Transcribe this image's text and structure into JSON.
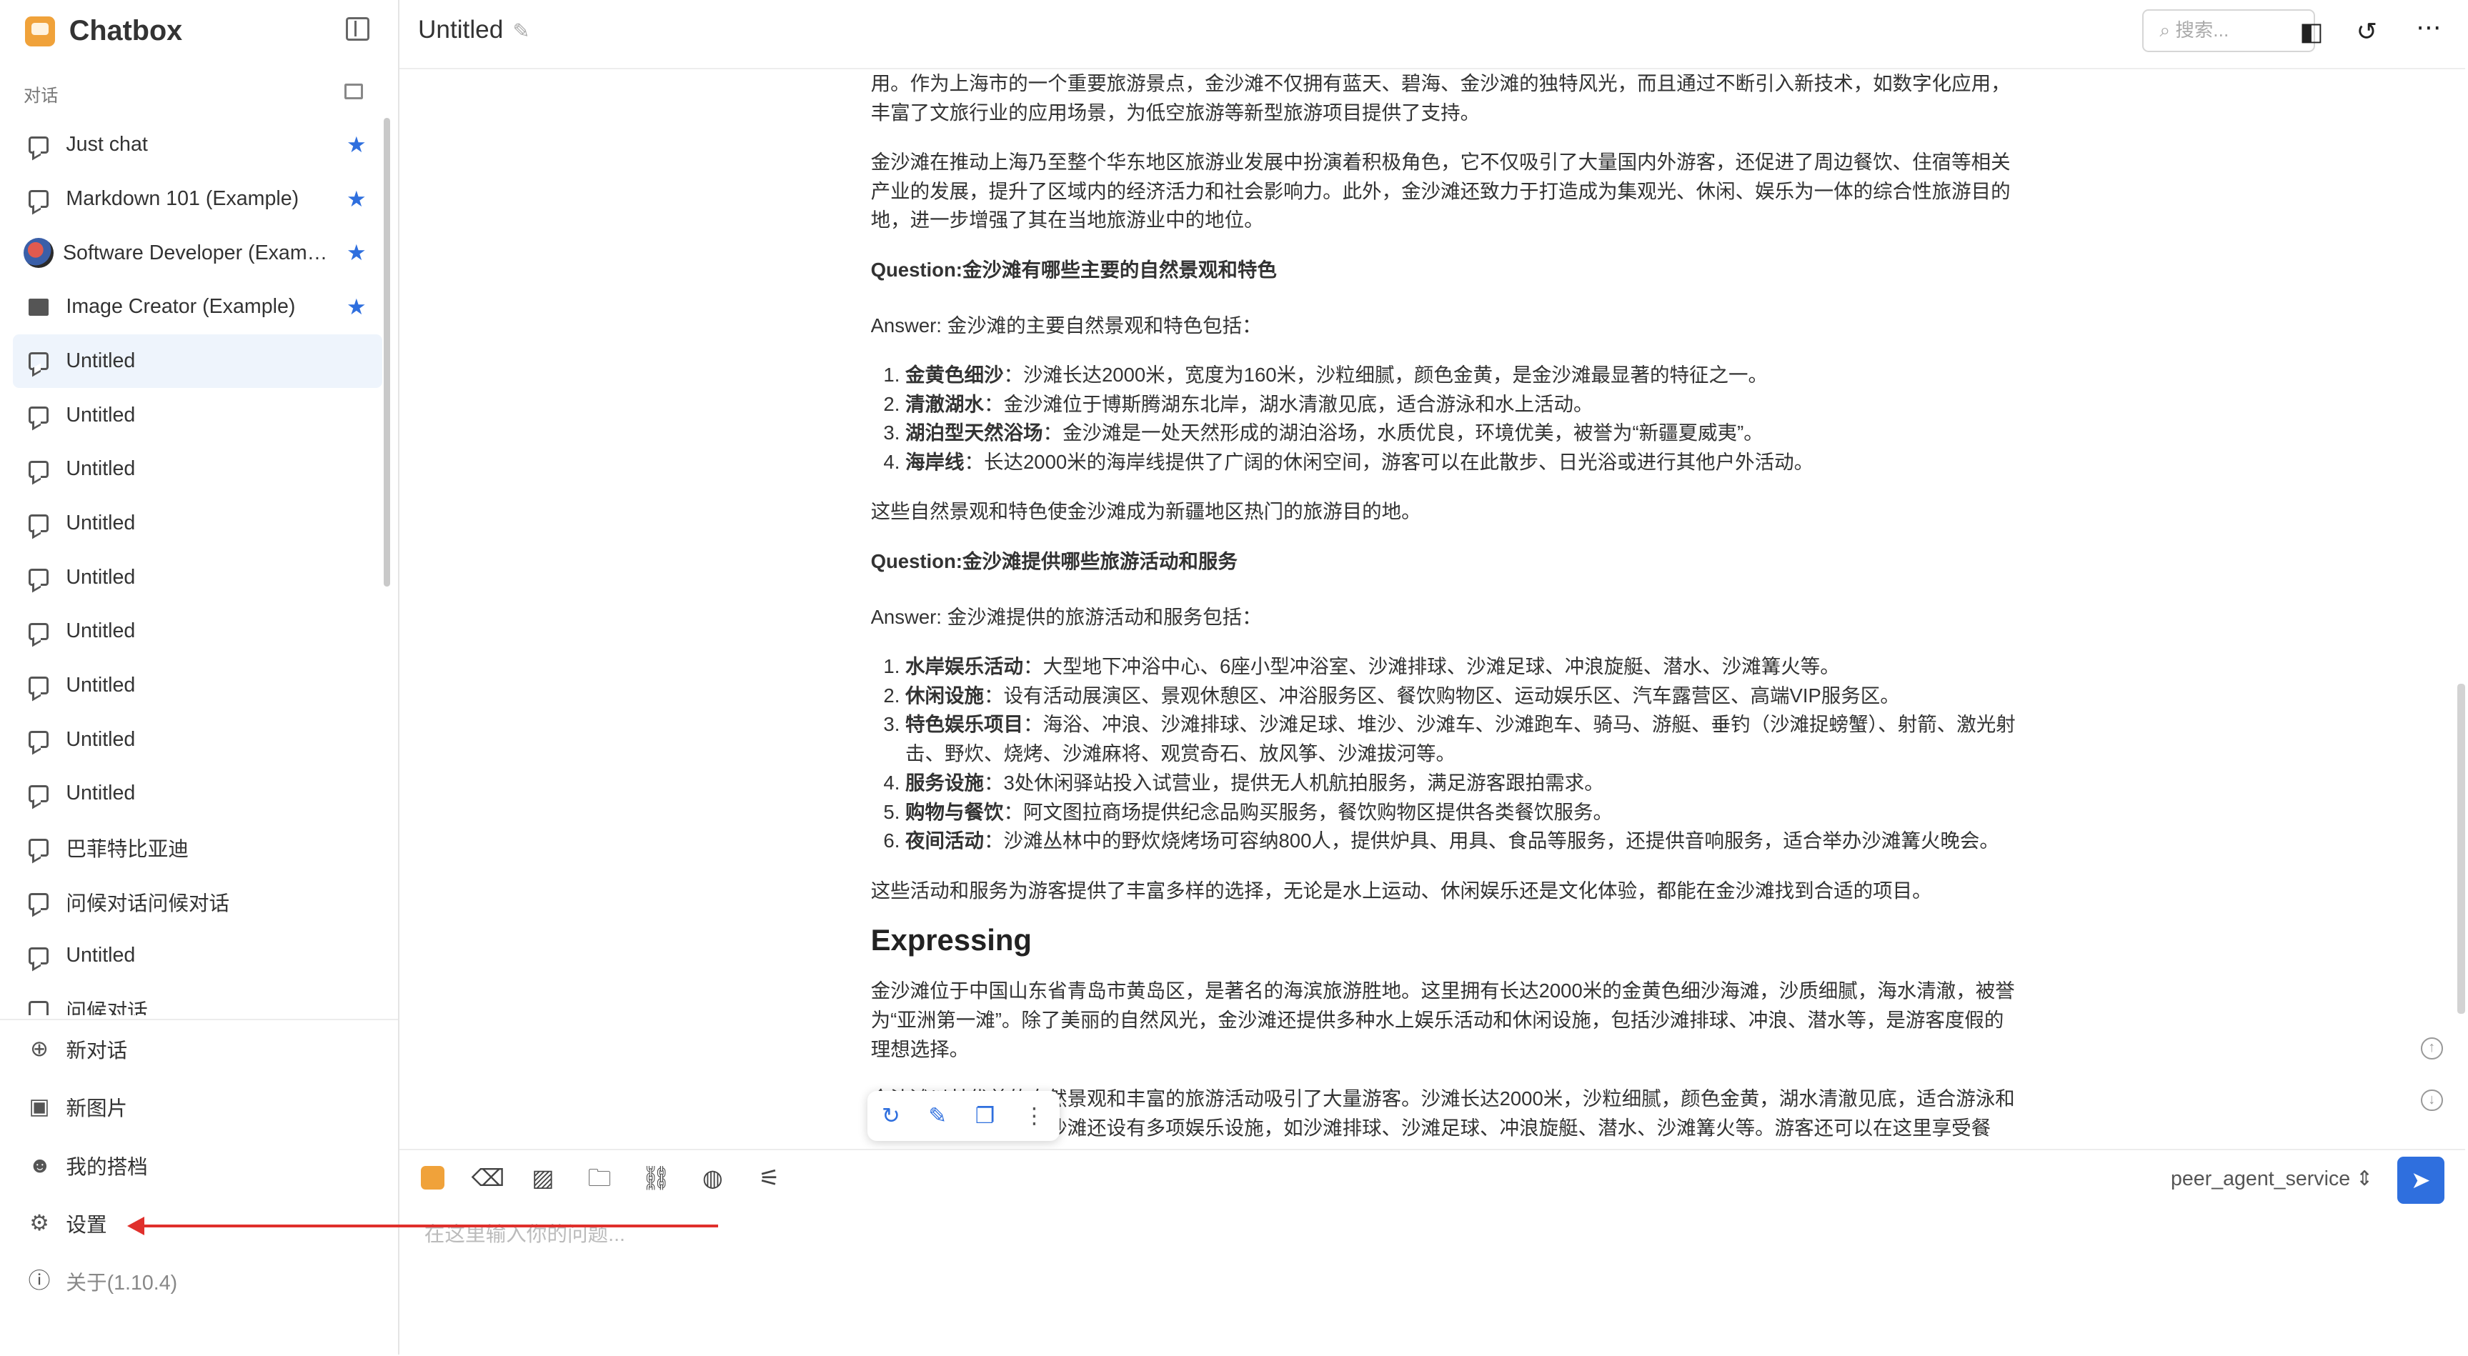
{
  "sidebar": {
    "app_name": "Chatbox",
    "section_label": "对话",
    "conversations": [
      {
        "label": "Just chat",
        "starred": true,
        "icon": "chat"
      },
      {
        "label": "Markdown 101 (Example)",
        "starred": true,
        "icon": "chat"
      },
      {
        "label": "Software Developer (Example)",
        "starred": true,
        "icon": "avatar"
      },
      {
        "label": "Image Creator (Example)",
        "starred": true,
        "icon": "image"
      },
      {
        "label": "Untitled",
        "active": true,
        "icon": "chat"
      },
      {
        "label": "Untitled",
        "icon": "chat"
      },
      {
        "label": "Untitled",
        "icon": "chat"
      },
      {
        "label": "Untitled",
        "icon": "chat"
      },
      {
        "label": "Untitled",
        "icon": "chat"
      },
      {
        "label": "Untitled",
        "icon": "chat"
      },
      {
        "label": "Untitled",
        "icon": "chat"
      },
      {
        "label": "Untitled",
        "icon": "chat"
      },
      {
        "label": "Untitled",
        "icon": "chat"
      },
      {
        "label": "巴菲特比亚迪",
        "icon": "chat"
      },
      {
        "label": "问候对话问候对话",
        "icon": "chat"
      },
      {
        "label": "Untitled",
        "icon": "chat"
      },
      {
        "label": "问候对话",
        "icon": "chat"
      }
    ],
    "menu": {
      "new_chat": "新对话",
      "new_image": "新图片",
      "my_copilots": "我的搭档",
      "settings": "设置",
      "about": "关于(1.10.4)"
    }
  },
  "header": {
    "title": "Untitled",
    "search_placeholder": "搜索..."
  },
  "content": {
    "p0": "用。作为上海市的一个重要旅游景点，金沙滩不仅拥有蓝天、碧海、金沙滩的独特风光，而且通过不断引入新技术，如数字化应用，丰富了文旅行业的应用场景，为低空旅游等新型旅游项目提供了支持。",
    "p1": "金沙滩在推动上海乃至整个华东地区旅游业发展中扮演着积极角色，它不仅吸引了大量国内外游客，还促进了周边餐饮、住宿等相关产业的发展，提升了区域内的经济活力和社会影响力。此外，金沙滩还致力于打造成为集观光、休闲、娱乐为一体的综合性旅游目的地，进一步增强了其在当地旅游业中的地位。",
    "q1": "Question:金沙滩有哪些主要的自然景观和特色",
    "a1_intro": "Answer: 金沙滩的主要自然景观和特色包括：",
    "list1": [
      {
        "k": "金黄色细沙",
        "v": "：沙滩长达2000米，宽度为160米，沙粒细腻，颜色金黄，是金沙滩最显著的特征之一。"
      },
      {
        "k": "清澈湖水",
        "v": "：金沙滩位于博斯腾湖东北岸，湖水清澈见底，适合游泳和水上活动。"
      },
      {
        "k": "湖泊型天然浴场",
        "v": "：金沙滩是一处天然形成的湖泊浴场，水质优良，环境优美，被誉为“新疆夏威夷”。"
      },
      {
        "k": "海岸线",
        "v": "：长达2000米的海岸线提供了广阔的休闲空间，游客可以在此散步、日光浴或进行其他户外活动。"
      }
    ],
    "a1_outro": "这些自然景观和特色使金沙滩成为新疆地区热门的旅游目的地。",
    "q2": "Question:金沙滩提供哪些旅游活动和服务",
    "a2_intro": "Answer: 金沙滩提供的旅游活动和服务包括：",
    "list2": [
      {
        "k": "水岸娱乐活动",
        "v": "：大型地下冲浴中心、6座小型冲浴室、沙滩排球、沙滩足球、冲浪旋艇、潜水、沙滩篝火等。"
      },
      {
        "k": "休闲设施",
        "v": "：设有活动展演区、景观休憩区、冲浴服务区、餐饮购物区、运动娱乐区、汽车露营区、高端VIP服务区。"
      },
      {
        "k": "特色娱乐项目",
        "v": "：海浴、冲浪、沙滩排球、沙滩足球、堆沙、沙滩车、沙滩跑车、骑马、游艇、垂钓（沙滩捉螃蟹）、射箭、激光射击、野炊、烧烤、沙滩麻将、观赏奇石、放风筝、沙滩拔河等。"
      },
      {
        "k": "服务设施",
        "v": "：3处休闲驿站投入试营业，提供无人机航拍服务，满足游客跟拍需求。"
      },
      {
        "k": "购物与餐饮",
        "v": "：阿文图拉商场提供纪念品购买服务，餐饮购物区提供各类餐饮服务。"
      },
      {
        "k": "夜间活动",
        "v": "：沙滩丛林中的野炊烧烤场可容纳800人，提供炉具、用具、食品等服务，还提供音响服务，适合举办沙滩篝火晚会。"
      }
    ],
    "a2_outro": "这些活动和服务为游客提供了丰富多样的选择，无论是水上运动、休闲娱乐还是文化体验，都能在金沙滩找到合适的项目。",
    "h_expressing": "Expressing",
    "p_exp1": "金沙滩位于中国山东省青岛市黄岛区，是著名的海滨旅游胜地。这里拥有长达2000米的金黄色细沙海滩，沙质细腻，海水清澈，被誉为“亚洲第一滩”。除了美丽的自然风光，金沙滩还提供多种水上娱乐活动和休闲设施，包括沙滩排球、冲浪、潜水等，是游客度假的理想选择。",
    "p_exp2": "金沙滩以其优美的自然景观和丰富的旅游活动吸引了大量游客。沙滩长达2000米，沙粒细腻，颜色金黄，湖水清澈见底，适合游泳和水上活动。此外，金沙滩还设有多项娱乐设施，如沙滩排球、沙滩足球、冲浪旋艇、潜水、沙滩篝火等。游客还可以在这里享受餐"
  },
  "input": {
    "placeholder": "在这里输入你的问题...",
    "model": "peer_agent_service"
  },
  "colors": {
    "accent": "#2f6fde",
    "annotation_arrow": "#e0302c",
    "brand": "#f0a23a"
  }
}
